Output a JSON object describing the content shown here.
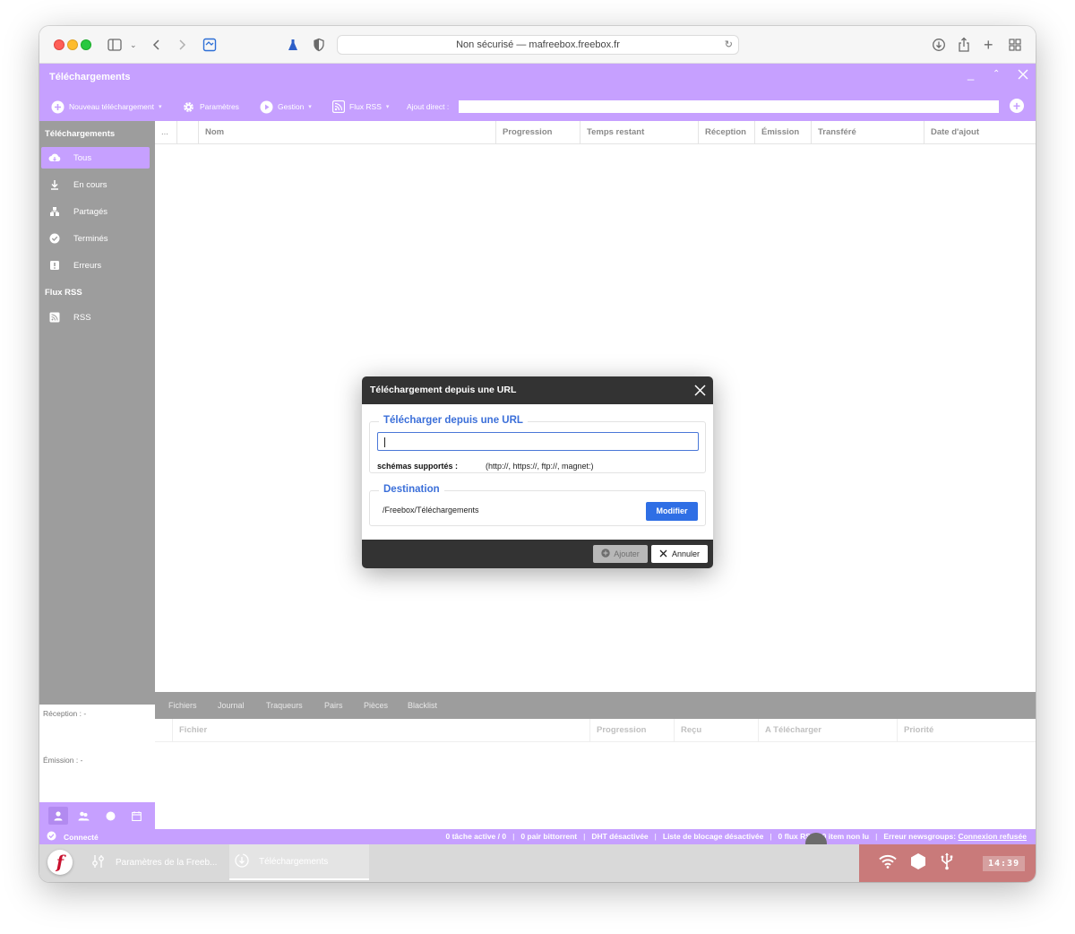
{
  "browser": {
    "address": "Non sécurisé — mafreebox.freebox.fr"
  },
  "app": {
    "title": "Téléchargements",
    "toolbar": {
      "new_download": "Nouveau téléchargement",
      "settings": "Paramètres",
      "manage": "Gestion",
      "rss": "Flux RSS",
      "direct_add": "Ajout direct :"
    }
  },
  "sidebar": {
    "downloads_header": "Téléchargements",
    "items": [
      {
        "label": "Tous",
        "icon": "cloud-download-icon",
        "active": true
      },
      {
        "label": "En cours",
        "icon": "download-arrow-icon"
      },
      {
        "label": "Partagés",
        "icon": "share-icon"
      },
      {
        "label": "Terminés",
        "icon": "check-circle-icon"
      },
      {
        "label": "Erreurs",
        "icon": "error-icon"
      }
    ],
    "rss_header": "Flux RSS",
    "rss_items": [
      {
        "label": "RSS",
        "icon": "rss-icon"
      }
    ],
    "stats": {
      "reception": "Réception : -",
      "emission": "Émission : -"
    }
  },
  "table": {
    "columns": [
      "...",
      "",
      "Nom",
      "Progression",
      "Temps restant",
      "Réception",
      "Émission",
      "Transféré",
      "Date d'ajout"
    ],
    "rows": []
  },
  "bottom_panel": {
    "tabs": [
      "Fichiers",
      "Journal",
      "Traqueurs",
      "Pairs",
      "Pièces",
      "Blacklist"
    ],
    "columns": [
      "Fichier",
      "Progression",
      "Reçu",
      "A Télécharger",
      "Priorité"
    ]
  },
  "status": {
    "connection": "Connecté",
    "tasks": "0 tâche active / 0",
    "peers": "0 pair bittorrent",
    "dht": "DHT désactivée",
    "blocklist": "Liste de blocage désactivée",
    "rss": "0 flux RSS / 0 item non lu",
    "newsgroups_label": "Erreur newsgroups:",
    "newsgroups_value": "Connexion refusée"
  },
  "taskbar": {
    "tasks": [
      {
        "label": "Paramètres de la Freeb...",
        "icon": "settings-sliders-icon"
      },
      {
        "label": "Téléchargements",
        "icon": "download-circle-icon",
        "active": true
      }
    ],
    "clock": "14:39"
  },
  "modal": {
    "title": "Téléchargement depuis une URL",
    "url_section": "Télécharger depuis une URL",
    "url_value": "",
    "schemes_label": "schémas supportés :",
    "schemes_value": "(http://, https://, ftp://, magnet:)",
    "destination_section": "Destination",
    "destination_path": "/Freebox/Téléchargements",
    "modify_button": "Modifier",
    "add_button": "Ajouter",
    "cancel_button": "Annuler"
  },
  "colors": {
    "accent": "#c6a0ff",
    "sidebar": "#9d9d9d",
    "link_blue": "#3b6fd9",
    "button_blue": "#2f6fe5",
    "modal_dark": "#333333",
    "tray": "#c97a7a"
  }
}
